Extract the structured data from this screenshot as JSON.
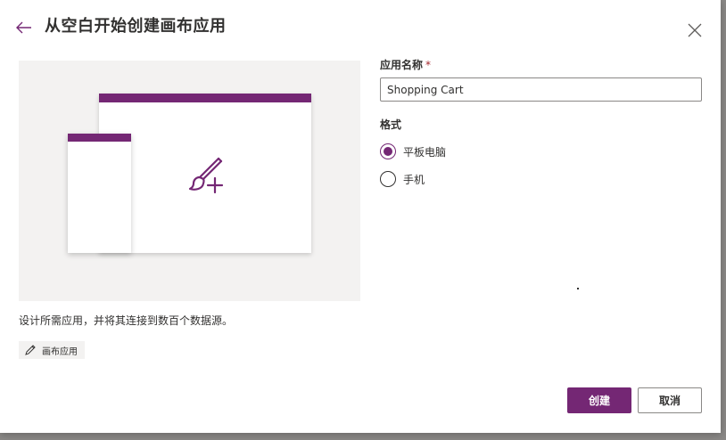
{
  "dialog": {
    "title": "从空白开始创建画布应用",
    "back_icon": "arrow-left-icon",
    "close_icon": "close-icon"
  },
  "preview": {
    "icon": "brush-plus-icon",
    "description": "设计所需应用，并将其连接到数百个数据源。",
    "tag_label": "画布应用",
    "tag_icon": "pencil-icon"
  },
  "form": {
    "app_name_label": "应用名称",
    "required_marker": "*",
    "app_name_value": "Shopping Cart",
    "format_label": "格式",
    "format_options": [
      {
        "label": "平板电脑",
        "selected": true
      },
      {
        "label": "手机",
        "selected": false
      }
    ]
  },
  "actions": {
    "create_label": "创建",
    "cancel_label": "取消"
  },
  "colors": {
    "accent": "#742774",
    "required": "#a4262c",
    "preview_bg": "#f3f2f1",
    "text": "#323130"
  }
}
